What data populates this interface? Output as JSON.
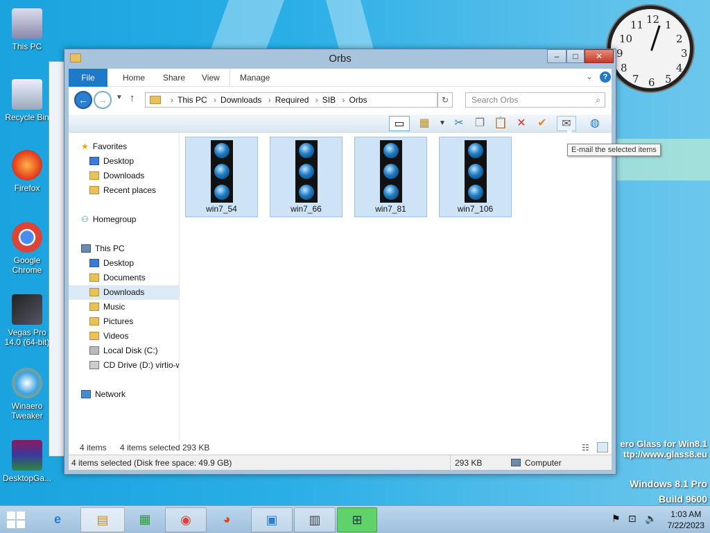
{
  "desktop": {
    "icons": [
      {
        "label": "This PC",
        "icon": "this-pc-icon"
      },
      {
        "label": "Recycle Bin",
        "icon": "recycle-bin-icon"
      },
      {
        "label": "Firefox",
        "icon": "firefox-icon"
      },
      {
        "label": "Google Chrome",
        "icon": "chrome-icon"
      },
      {
        "label": "Vegas Pro 14.0 (64-bit)",
        "icon": "vegas-icon"
      },
      {
        "label": "Winaero Tweaker",
        "icon": "winaero-icon"
      },
      {
        "label": "DesktopGa...",
        "icon": "winrar-icon"
      }
    ],
    "watermark": {
      "line1": "ero Glass for Win8.1",
      "line2": "ttp://www.glass8.eu",
      "line3": "Windows 8.1 Pro",
      "line4": "Build 9600"
    }
  },
  "clock": {
    "numbers": [
      "12",
      "1",
      "2",
      "3",
      "4",
      "5",
      "6",
      "7",
      "8",
      "9",
      "10",
      "11"
    ]
  },
  "window": {
    "title": "Orbs",
    "controls": {
      "minimize": "–",
      "maximize": "□",
      "close": "✕"
    },
    "ribbon_tabs": [
      "File",
      "Home",
      "Share",
      "View",
      "Manage"
    ],
    "breadcrumb": [
      "This PC",
      "Downloads",
      "Required",
      "SIB",
      "Orbs"
    ],
    "search_placeholder": "Search Orbs",
    "tooltip": "E-mail the selected items",
    "nav": {
      "favorites": "Favorites",
      "favorites_items": [
        "Desktop",
        "Downloads",
        "Recent places"
      ],
      "homegroup": "Homegroup",
      "thispc": "This PC",
      "thispc_items": [
        "Desktop",
        "Documents",
        "Downloads",
        "Music",
        "Pictures",
        "Videos",
        "Local Disk (C:)",
        "CD Drive (D:) virtio-w"
      ],
      "network": "Network"
    },
    "files": [
      "win7_54",
      "win7_66",
      "win7_81",
      "win7_106"
    ],
    "status": {
      "items": "4 items",
      "selected": "4 items selected",
      "size": "293 KB"
    },
    "details": {
      "summary": "4 items selected (Disk free space: 49.9 GB)",
      "size": "293 KB",
      "location": "Computer"
    }
  },
  "taskbar": {
    "time": "1:03 AM",
    "date": "7/22/2023"
  }
}
